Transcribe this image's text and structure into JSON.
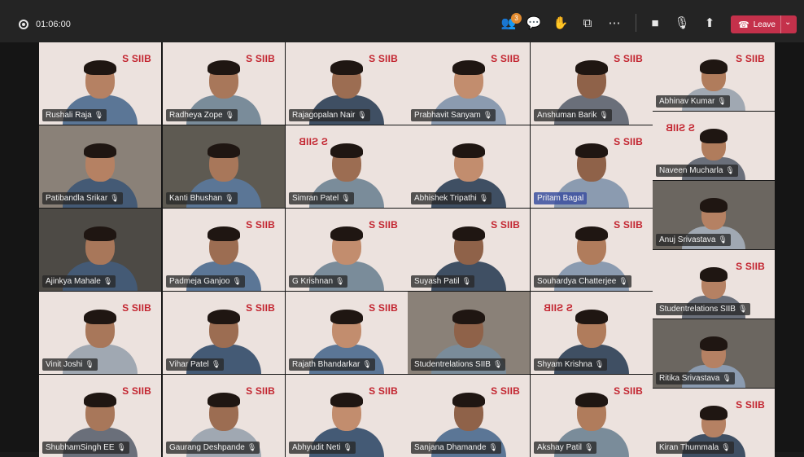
{
  "meeting": {
    "timer": "01:06:00",
    "chat_badge": "3",
    "leave_label": "Leave"
  },
  "toolbar_icons": [
    {
      "name": "participants-icon",
      "glyph": "👥"
    },
    {
      "name": "chat-icon",
      "glyph": "💬"
    },
    {
      "name": "reactions-icon",
      "glyph": "✋"
    },
    {
      "name": "rooms-icon",
      "glyph": "⧉"
    },
    {
      "name": "more-icon",
      "glyph": "⋯"
    },
    {
      "name": "camera-icon",
      "glyph": "■"
    },
    {
      "name": "mic-muted-icon",
      "glyph": "🎙"
    },
    {
      "name": "share-icon",
      "glyph": "⬆"
    }
  ],
  "logo_text": "SIIB",
  "colors": {
    "leave": "#c4314b",
    "logo": "#c32530",
    "tile_bg": "#ece2de"
  },
  "participants": [
    {
      "name": "Rushali Raja",
      "logo": true,
      "mirror": false,
      "dark": false
    },
    {
      "name": "Radheya Zope",
      "logo": true,
      "mirror": false,
      "dark": false
    },
    {
      "name": "Rajagopalan Nair",
      "logo": true,
      "mirror": false,
      "dark": false
    },
    {
      "name": "Prabhavit  Sanyam",
      "logo": true,
      "mirror": false,
      "dark": false
    },
    {
      "name": "Anshuman  Barik",
      "logo": true,
      "mirror": false,
      "dark": false
    },
    {
      "name": "Abhinav  Kumar",
      "logo": true,
      "mirror": false,
      "dark": false
    },
    {
      "name": "Patibandla Srikar",
      "logo": false,
      "mirror": false,
      "dark": true
    },
    {
      "name": "Kanti  Bhushan",
      "logo": false,
      "mirror": false,
      "dark": true
    },
    {
      "name": "Simran  Patel",
      "logo": true,
      "mirror": true,
      "dark": false
    },
    {
      "name": "Abhishek Tripathi",
      "logo": false,
      "mirror": false,
      "dark": false
    },
    {
      "name": "Pritam  Bagal",
      "logo": true,
      "mirror": false,
      "dark": false,
      "highlight": true
    },
    {
      "name": "Naveen Mucharla",
      "logo": true,
      "mirror": true,
      "dark": false
    },
    {
      "name": "Anuj Srivastava",
      "logo": false,
      "mirror": false,
      "dark": true
    },
    {
      "name": "Ajinkya Mahale",
      "logo": false,
      "mirror": false,
      "dark": true
    },
    {
      "name": "Padmeja Ganjoo",
      "logo": true,
      "mirror": false,
      "dark": false
    },
    {
      "name": "G Krishnan",
      "logo": true,
      "mirror": false,
      "dark": false
    },
    {
      "name": "Suyash Patil",
      "logo": true,
      "mirror": false,
      "dark": false
    },
    {
      "name": "Souhardya Chatterjee",
      "logo": true,
      "mirror": false,
      "dark": false
    },
    {
      "name": "Studentrelations SIIB",
      "logo": true,
      "mirror": false,
      "dark": false
    },
    {
      "name": "Vinit Joshi",
      "logo": true,
      "mirror": false,
      "dark": false
    },
    {
      "name": "Vihar  Patel",
      "logo": true,
      "mirror": false,
      "dark": false
    },
    {
      "name": "Rajath Bhandarkar",
      "logo": true,
      "mirror": false,
      "dark": false
    },
    {
      "name": "Studentrelations SIIB",
      "logo": false,
      "mirror": false,
      "dark": true
    },
    {
      "name": "Shyam Krishna",
      "logo": true,
      "mirror": true,
      "dark": false
    },
    {
      "name": "Ritika Srivastava",
      "logo": false,
      "mirror": false,
      "dark": true
    },
    {
      "name": "ShubhamSingh EE",
      "logo": true,
      "mirror": false,
      "dark": false
    },
    {
      "name": "Gaurang  Deshpande",
      "logo": true,
      "mirror": false,
      "dark": false
    },
    {
      "name": "Abhyudit Neti",
      "logo": true,
      "mirror": false,
      "dark": false
    },
    {
      "name": "Sanjana  Dhamande",
      "logo": true,
      "mirror": false,
      "dark": false
    },
    {
      "name": "Akshay Patil",
      "logo": true,
      "mirror": false,
      "dark": false
    },
    {
      "name": "Kiran Thummala",
      "logo": true,
      "mirror": false,
      "dark": false
    }
  ]
}
